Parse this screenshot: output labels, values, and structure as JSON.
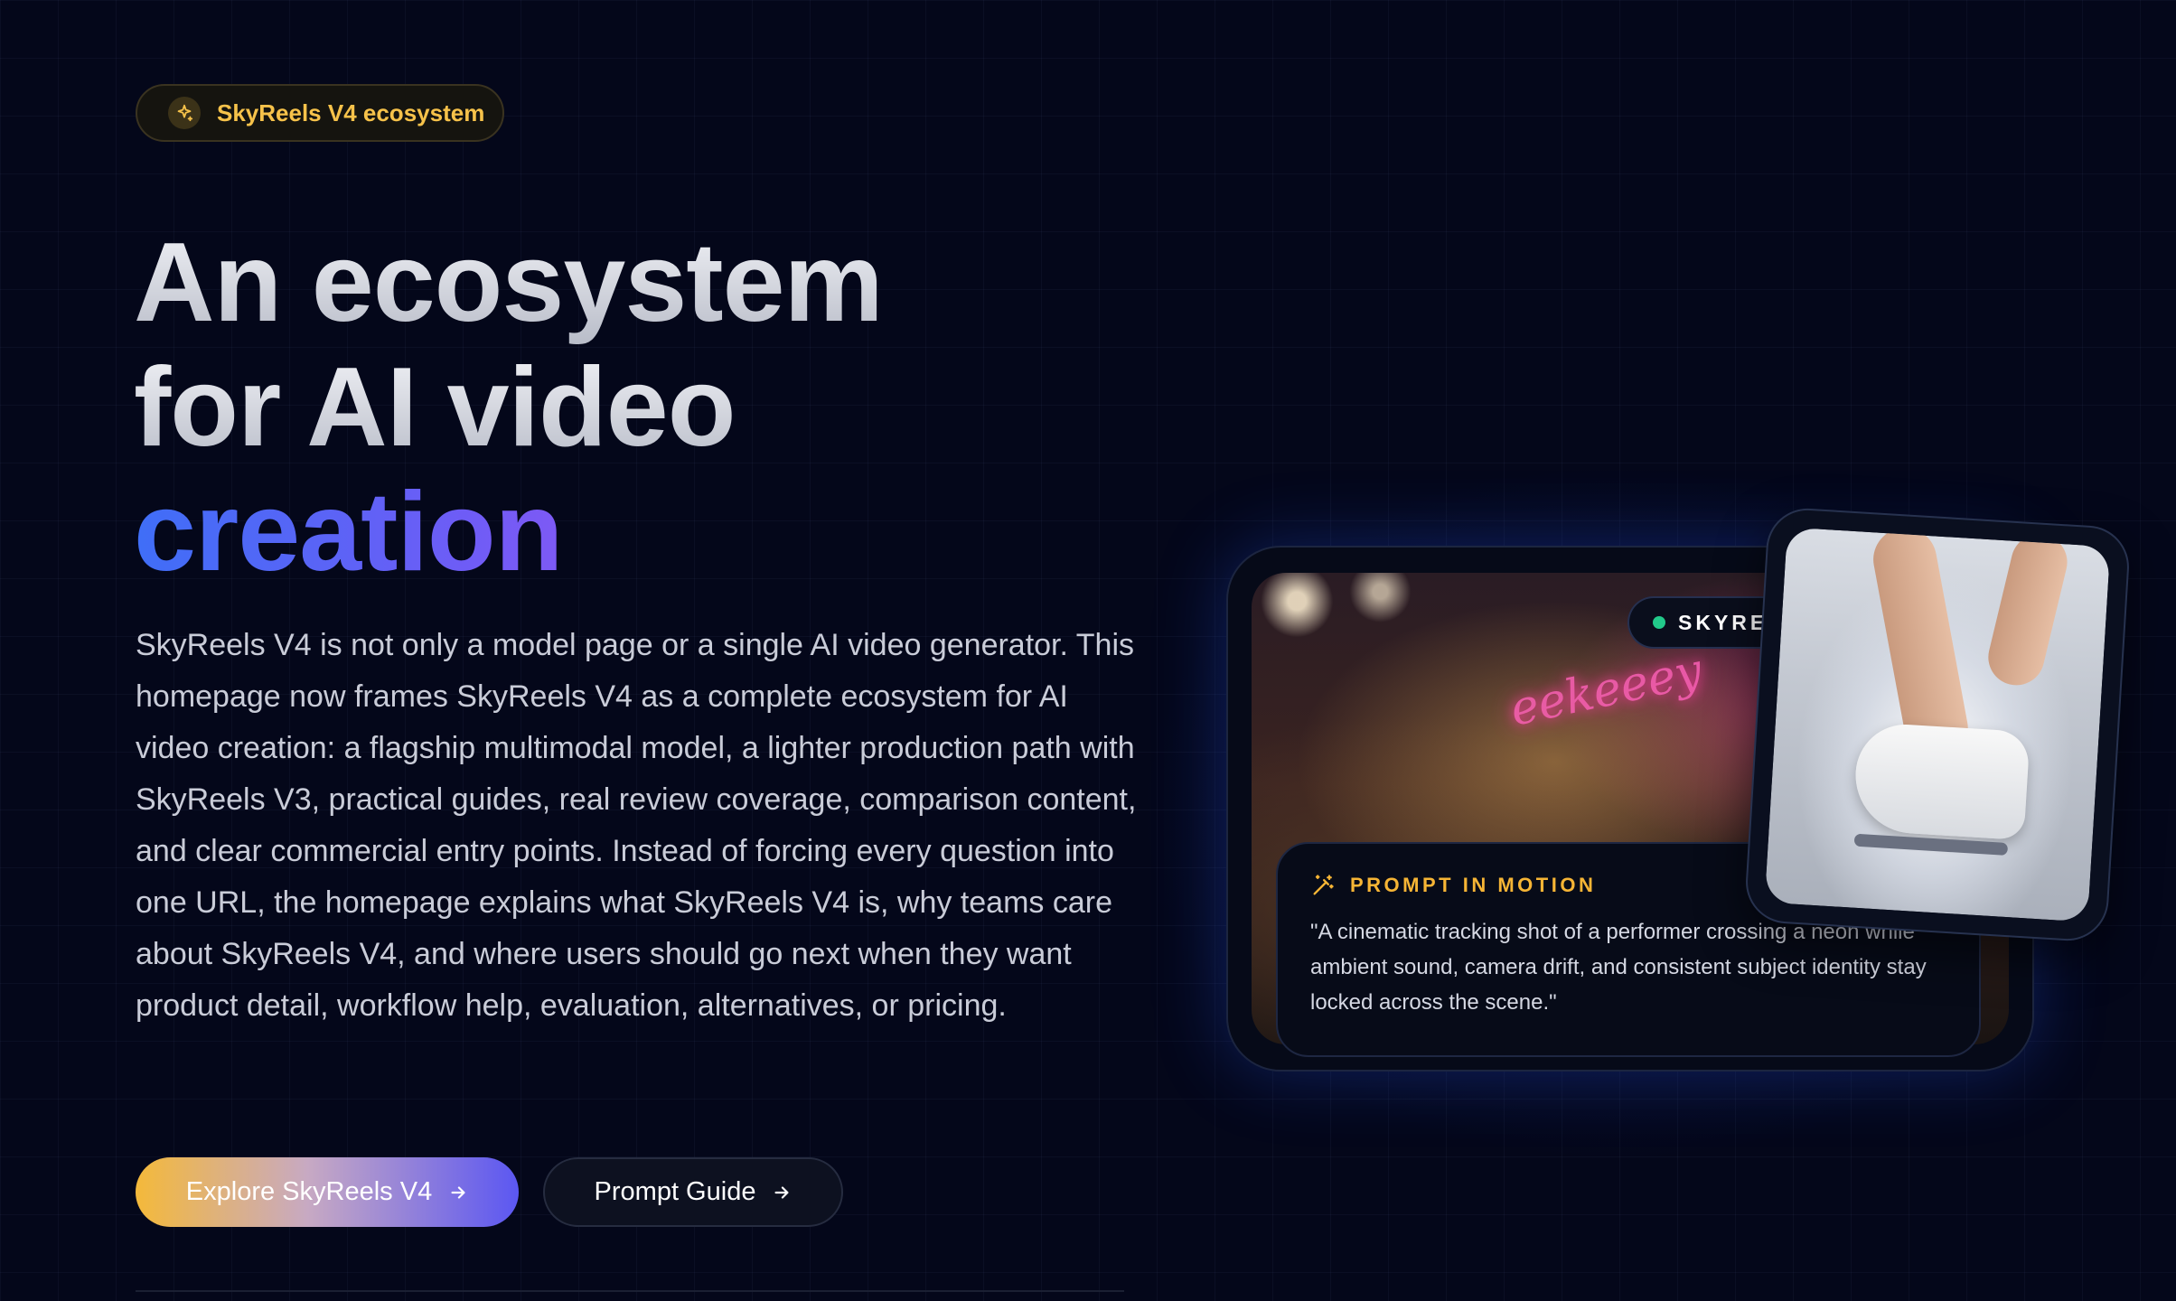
{
  "badge": {
    "label": "SkyReels V4 ecosystem",
    "icon": "sparkle-icon"
  },
  "hero": {
    "line1": "An ecosystem",
    "line2": "for AI video",
    "line3": "creation",
    "paragraph": "SkyReels V4 is not only a model page or a single AI video generator. This homepage now frames SkyReels V4 as a complete ecosystem for AI video creation: a flagship multimodal model, a lighter production path with SkyReels V3, practical guides, real review coverage, comparison content, and clear commercial entry points. Instead of forcing every question into one URL, the homepage explains what SkyReels V4 is, why teams care about SkyReels V4, and where users should go next when they want product detail, workflow help, evaluation, alternatives, or pricing."
  },
  "buttons": {
    "primary": "Explore SkyReels V4",
    "secondary": "Prompt Guide"
  },
  "showcase": {
    "chip": "SKYRE",
    "neon_sign": "eekeeey",
    "prompt_title": "PROMPT IN MOTION",
    "prompt_quote": "\"A cinematic tracking shot of a performer crossing a neon while ambient sound, camera drift, and consistent subject identity stay locked across the scene.\""
  },
  "colors": {
    "background": "#04071a",
    "accent_gold": "#f6c24a",
    "accent_blue": "#3f6ef7",
    "accent_purple": "#b14ff0",
    "live_dot": "#22c98a"
  }
}
